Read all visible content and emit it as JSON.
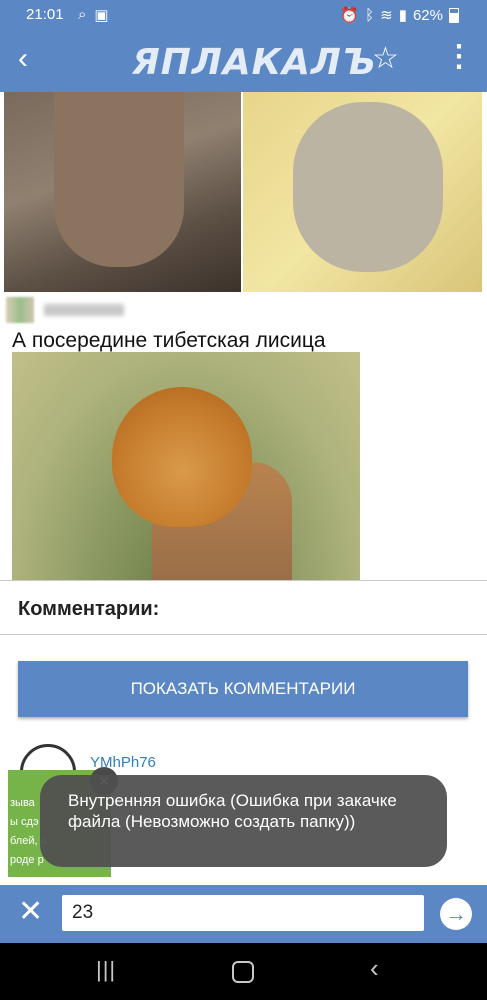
{
  "status_bar": {
    "time": "21:01",
    "battery_percent": "62%",
    "icons": [
      "search-icon",
      "media-icon",
      "alarm-icon",
      "bluetooth-icon",
      "wifi-icon",
      "signal-icon",
      "battery-icon"
    ]
  },
  "app_bar": {
    "logo": "ЯПЛАКАЛЪ",
    "back_icon": "‹",
    "star_icon": "☆",
    "more_icon": "⋮"
  },
  "post": {
    "caption": "А посередине тибетская лисица"
  },
  "comments": {
    "title": "Комментарии:",
    "show_button": "ПОКАЗАТЬ КОММЕНТАРИИ",
    "first_user": "YMhPh76"
  },
  "ad": {
    "lines": [
      "зыва",
      "ы сдэ",
      "блей, а",
      "роде р"
    ],
    "close_icon": "×"
  },
  "toast": {
    "message": "Внутренняя ошибка (Ошибка при закачке файла (Невозможно создать папку))"
  },
  "search": {
    "value": "23",
    "close_icon": "✕",
    "go_icon": "→"
  },
  "colors": {
    "accent": "#5b87c5",
    "ad_green": "#76b44a",
    "link": "#2f7fbf"
  }
}
